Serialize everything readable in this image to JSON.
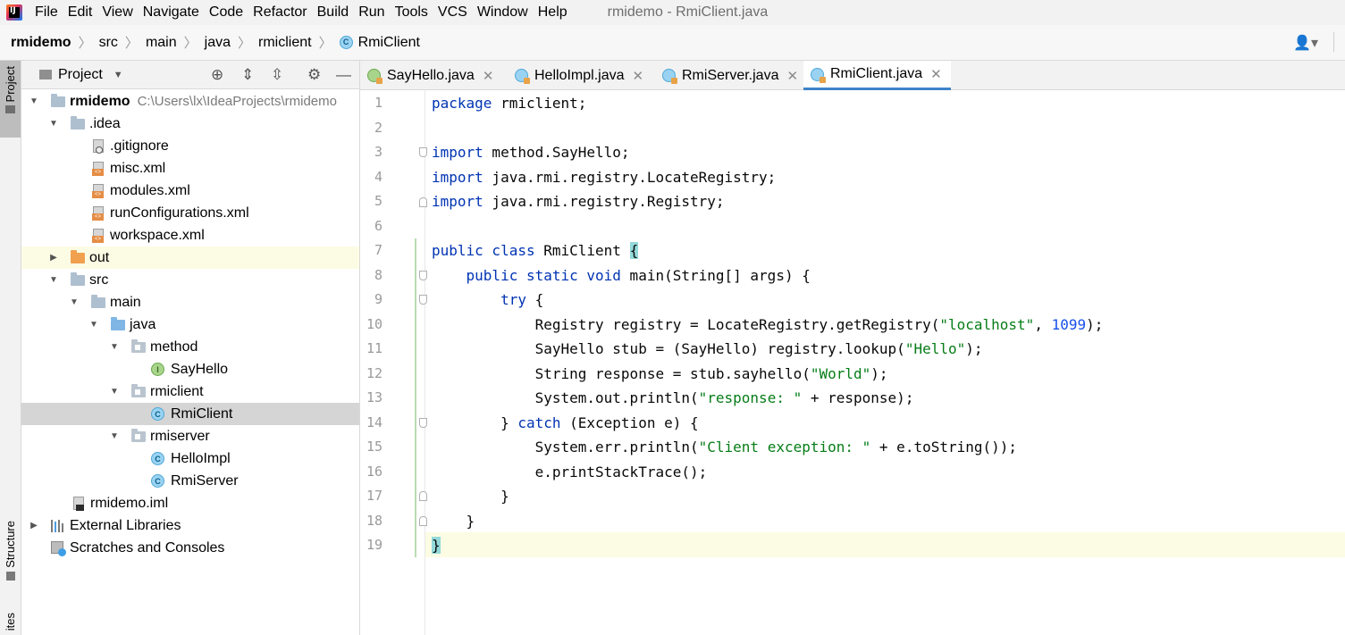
{
  "window": {
    "title": "rmidemo - RmiClient.java",
    "menu": [
      "File",
      "Edit",
      "View",
      "Navigate",
      "Code",
      "Refactor",
      "Build",
      "Run",
      "Tools",
      "VCS",
      "Window",
      "Help"
    ]
  },
  "breadcrumb": [
    "rmidemo",
    "src",
    "main",
    "java",
    "rmiclient",
    "RmiClient"
  ],
  "left_strip": {
    "project": "Project",
    "structure": "Structure",
    "favorites": "ites"
  },
  "project_panel": {
    "title": "Project",
    "tree": [
      {
        "label": "rmidemo",
        "hint": "C:\\Users\\lx\\IdeaProjects\\rmidemo",
        "icon": "module-folder-icon"
      },
      {
        "label": ".idea",
        "icon": "folder-icon"
      },
      {
        "label": ".gitignore",
        "icon": "ignore-file-icon"
      },
      {
        "label": "misc.xml",
        "icon": "xml-file-icon"
      },
      {
        "label": "modules.xml",
        "icon": "xml-file-icon"
      },
      {
        "label": "runConfigurations.xml",
        "icon": "xml-file-icon"
      },
      {
        "label": "workspace.xml",
        "icon": "xml-file-icon"
      },
      {
        "label": "out",
        "icon": "excluded-folder-icon"
      },
      {
        "label": "src",
        "icon": "folder-icon"
      },
      {
        "label": "main",
        "icon": "folder-icon"
      },
      {
        "label": "java",
        "icon": "source-folder-icon"
      },
      {
        "label": "method",
        "icon": "package-icon"
      },
      {
        "label": "SayHello",
        "icon": "interface-icon"
      },
      {
        "label": "rmiclient",
        "icon": "package-icon"
      },
      {
        "label": "RmiClient",
        "icon": "class-icon"
      },
      {
        "label": "rmiserver",
        "icon": "package-icon"
      },
      {
        "label": "HelloImpl",
        "icon": "class-icon"
      },
      {
        "label": "RmiServer",
        "icon": "class-icon"
      },
      {
        "label": "rmidemo.iml",
        "icon": "iml-file-icon"
      },
      {
        "label": "External Libraries",
        "icon": "libraries-icon"
      },
      {
        "label": "Scratches and Consoles",
        "icon": "scratches-icon"
      }
    ]
  },
  "tabs": [
    {
      "label": "SayHello.java",
      "icon": "interface-icon",
      "active": false
    },
    {
      "label": "HelloImpl.java",
      "icon": "class-icon",
      "active": false
    },
    {
      "label": "RmiServer.java",
      "icon": "class-icon",
      "active": false
    },
    {
      "label": "RmiClient.java",
      "icon": "class-icon",
      "active": true
    }
  ],
  "editor": {
    "line_numbers": [
      "1",
      "2",
      "3",
      "4",
      "5",
      "6",
      "7",
      "8",
      "9",
      "10",
      "11",
      "12",
      "13",
      "14",
      "15",
      "16",
      "17",
      "18",
      "19"
    ],
    "code": {
      "l1": [
        "package",
        " rmiclient;"
      ],
      "l3": [
        "import",
        " method.SayHello;"
      ],
      "l4": [
        "import",
        " java.rmi.registry.LocateRegistry;"
      ],
      "l5": [
        "import",
        " java.rmi.registry.Registry;"
      ],
      "l7": [
        "public class",
        " RmiClient ",
        "{"
      ],
      "l8": [
        "    ",
        "public static void",
        " main(String[] args) {"
      ],
      "l9": [
        "        ",
        "try",
        " {"
      ],
      "l10": [
        "            Registry registry = LocateRegistry.getRegistry(",
        "\"localhost\"",
        ", ",
        "1099",
        ");"
      ],
      "l11": [
        "            SayHello stub = (SayHello) registry.lookup(",
        "\"Hello\"",
        ");"
      ],
      "l12": [
        "            String response = stub.sayhello(",
        "\"World\"",
        ");"
      ],
      "l13": [
        "            System.out.println(",
        "\"response: \"",
        " + response);"
      ],
      "l14": [
        "        } ",
        "catch",
        " (Exception e) {"
      ],
      "l15": [
        "            System.err.println(",
        "\"Client exception: \"",
        " + e.toString());"
      ],
      "l16": [
        "            e.printStackTrace();"
      ],
      "l17": [
        "        }"
      ],
      "l18": [
        "    }"
      ],
      "l19": [
        "}"
      ]
    }
  }
}
